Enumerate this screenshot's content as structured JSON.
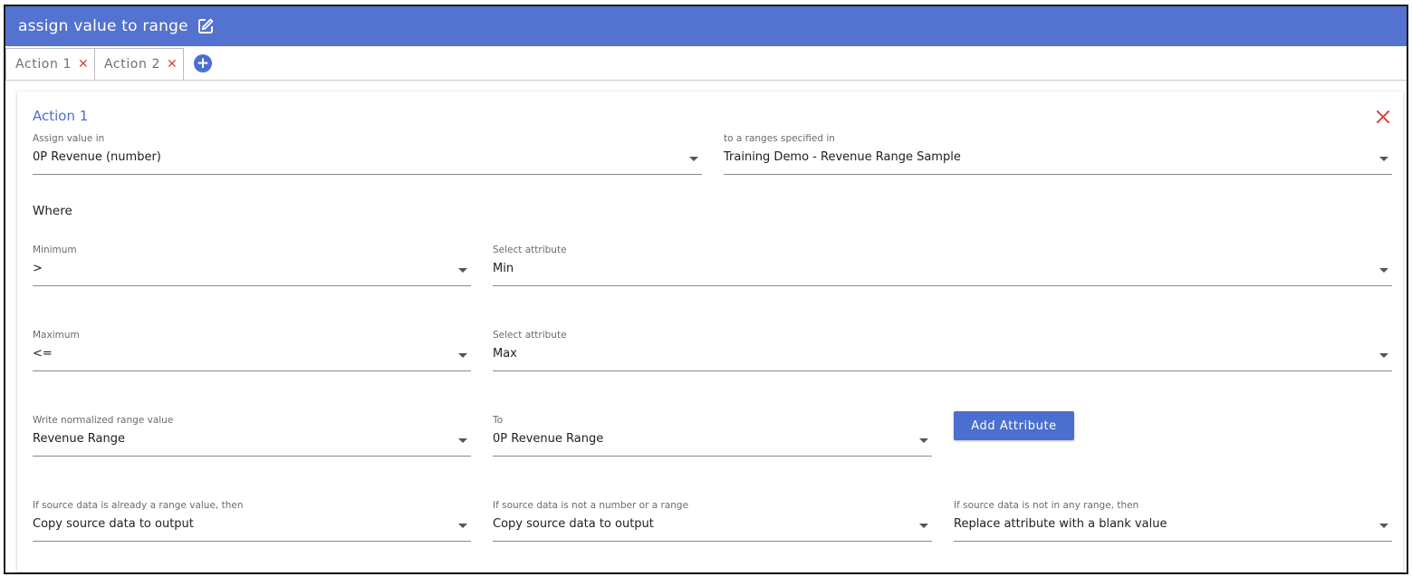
{
  "header": {
    "title": "assign value to range",
    "edit_icon": "edit-icon"
  },
  "tabs": [
    {
      "label": "Action 1",
      "close": "✕"
    },
    {
      "label": "Action 2",
      "close": "✕"
    }
  ],
  "add_tab_icon": "+",
  "action": {
    "title": "Action 1",
    "close_icon": "close-icon",
    "assign_value_in": {
      "label": "Assign value in",
      "value": "0P Revenue (number)"
    },
    "ranges_specified_in": {
      "label": "to a ranges specified in",
      "value": "Training Demo - Revenue Range Sample"
    },
    "where_label": "Where",
    "minimum": {
      "label": "Minimum",
      "value": ">"
    },
    "minimum_attribute": {
      "label": "Select attribute",
      "value": "Min"
    },
    "maximum": {
      "label": "Maximum",
      "value": "<="
    },
    "maximum_attribute": {
      "label": "Select attribute",
      "value": "Max"
    },
    "write_normalized": {
      "label": "Write normalized range value",
      "value": "Revenue Range"
    },
    "to": {
      "label": "To",
      "value": "0P Revenue Range"
    },
    "add_attribute_label": "Add Attribute",
    "if_range_value": {
      "label": "If source data is already a range value, then",
      "value": "Copy source data to output"
    },
    "if_not_number": {
      "label": "If source data is not a number or a range",
      "value": "Copy source data to output"
    },
    "if_not_in_range": {
      "label": "If source data is not in any range, then",
      "value": "Replace attribute with a blank value"
    }
  },
  "colors": {
    "accent": "#5472cf",
    "button": "#4b6fd0",
    "close": "#d64545"
  }
}
